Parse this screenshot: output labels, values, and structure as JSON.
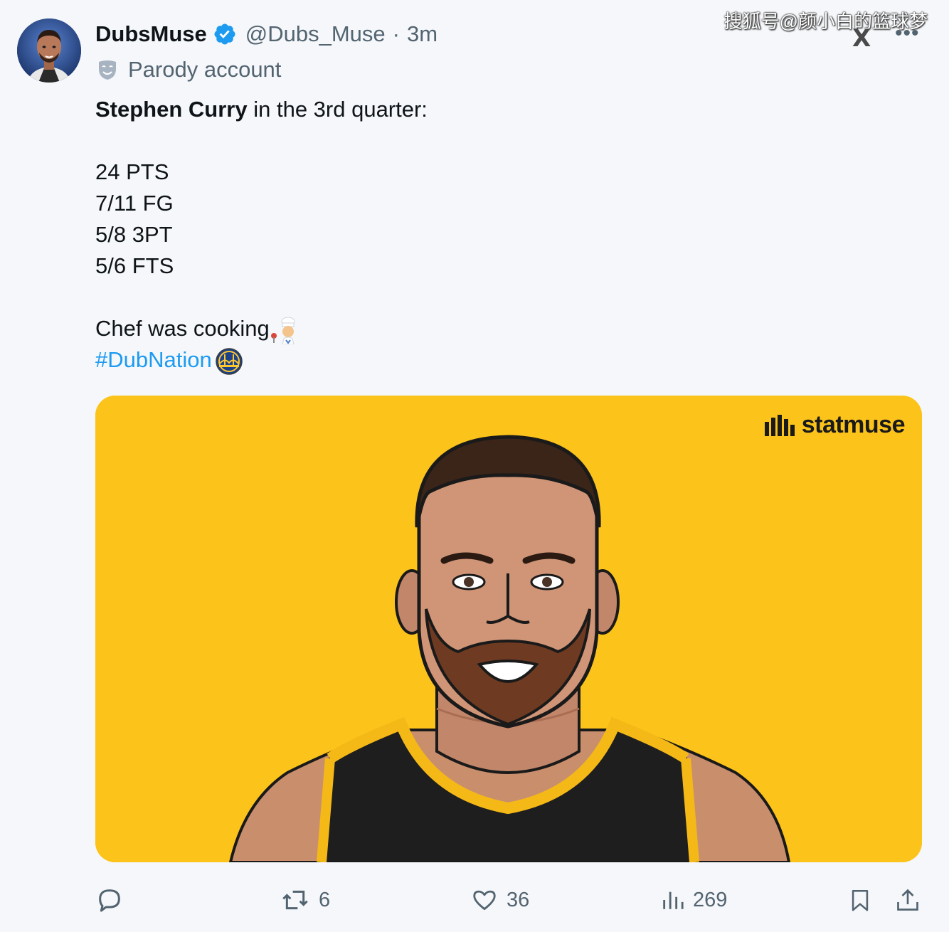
{
  "watermark": "搜狐号@颜小白的篮球梦",
  "tweet": {
    "author": {
      "display_name": "DubsMuse",
      "handle": "@Dubs_Muse",
      "separator": "·",
      "time": "3m",
      "badge_label": "Parody account",
      "verified": true
    },
    "text": {
      "intro_bold": "Stephen Curry",
      "intro_rest": " in the 3rd quarter:",
      "stats": [
        "24 PTS",
        "7/11 FG",
        "5/8 3PT",
        "5/6 FTS"
      ],
      "closing": "Chef was cooking",
      "hashtag": "#DubNation"
    },
    "media": {
      "brand": "statmuse",
      "background_color": "#fcc31b"
    },
    "actions": {
      "replies": "",
      "reposts": "6",
      "likes": "36",
      "views": "269"
    }
  },
  "icons": {
    "more": "more-options-icon",
    "x_logo": "x-logo-icon"
  },
  "colors": {
    "accent": "#1d9bf0",
    "muted": "#536471",
    "text": "#0f1419",
    "background": "#f5f7fa"
  }
}
